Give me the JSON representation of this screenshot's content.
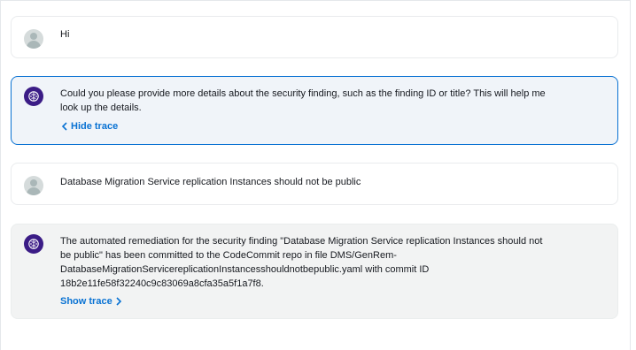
{
  "messages": [
    {
      "role": "user",
      "text": "Hi"
    },
    {
      "role": "assistant",
      "text": "Could you please provide more details about the security finding, such as the finding ID or title? This will help me look up the details.",
      "trace_label": "Hide trace"
    },
    {
      "role": "user",
      "text": "Database Migration Service replication Instances should not be public"
    },
    {
      "role": "assistant",
      "text": "The automated remediation for the security finding \"Database Migration Service replication Instances should not be public\" has been committed to the CodeCommit repo in file DMS/GenRem-DatabaseMigrationServicereplicationInstancesshouldnotbepublic.yaml with commit ID 18b2e11fe58f32240c9c83069a8cfa35a5f1a7f8.",
      "trace_label": "Show trace"
    }
  ],
  "icons": {
    "user_avatar": "user-avatar-icon",
    "bot_avatar": "brain-bot-icon",
    "hide_trace": "chevron-left-icon",
    "show_trace": "chevron-right-icon"
  },
  "colors": {
    "link": "#0972d3",
    "active_border": "#0972d3",
    "bot_avatar_bg": "#3b1c86"
  }
}
